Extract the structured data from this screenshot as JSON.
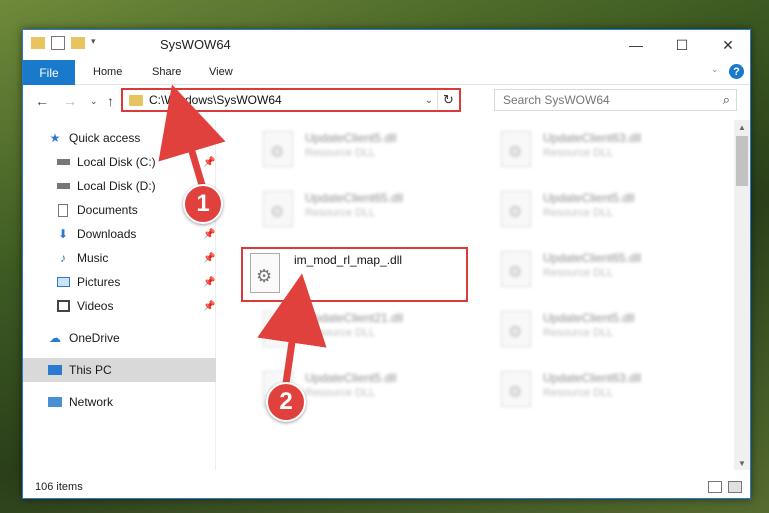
{
  "window": {
    "title": "SysWOW64",
    "controls": {
      "minimize": "—",
      "maximize": "☐",
      "close": "✕"
    }
  },
  "ribbon": {
    "tabs": [
      "File",
      "Home",
      "Share",
      "View"
    ],
    "help": "?"
  },
  "navigation": {
    "address": "C:\\Windows\\SysWOW64",
    "search_placeholder": "Search SysWOW64"
  },
  "sidebar": {
    "items": [
      {
        "label": "Quick access",
        "icon": "star-icon"
      },
      {
        "label": "Local Disk (C:)",
        "icon": "drive-icon"
      },
      {
        "label": "Local Disk (D:)",
        "icon": "drive-icon"
      },
      {
        "label": "Documents",
        "icon": "documents-icon"
      },
      {
        "label": "Downloads",
        "icon": "downloads-icon"
      },
      {
        "label": "Music",
        "icon": "music-icon"
      },
      {
        "label": "Pictures",
        "icon": "pictures-icon"
      },
      {
        "label": "Videos",
        "icon": "videos-icon"
      },
      {
        "label": "OneDrive",
        "icon": "onedrive-icon"
      },
      {
        "label": "This PC",
        "icon": "computer-icon",
        "selected": true
      },
      {
        "label": "Network",
        "icon": "network-icon"
      }
    ]
  },
  "files": {
    "left": [
      {
        "name": "UpdateClient5.dll",
        "type": "Resource DLL"
      },
      {
        "name": "UpdateClient65.dll",
        "type": "Resource DLL"
      },
      {
        "name": "UpdateClient21.dll",
        "type": "Resource DLL"
      },
      {
        "name": "UpdateClient5.dll",
        "type": "Resource DLL"
      }
    ],
    "right": [
      {
        "name": "UpdateClient63.dll",
        "type": "Resource DLL"
      },
      {
        "name": "UpdateClient5.dll",
        "type": "Resource DLL"
      },
      {
        "name": "UpdateClient65.dll",
        "type": "Resource DLL"
      },
      {
        "name": "UpdateClient5.dll",
        "type": "Resource DLL"
      },
      {
        "name": "UpdateClient63.dll",
        "type": "Resource DLL"
      }
    ],
    "target": {
      "name": "im_mod_rl_map_.dll"
    }
  },
  "status": {
    "item_count": "106 items"
  },
  "annotations": {
    "badge1": "1",
    "badge2": "2",
    "color": "#e1413d"
  }
}
